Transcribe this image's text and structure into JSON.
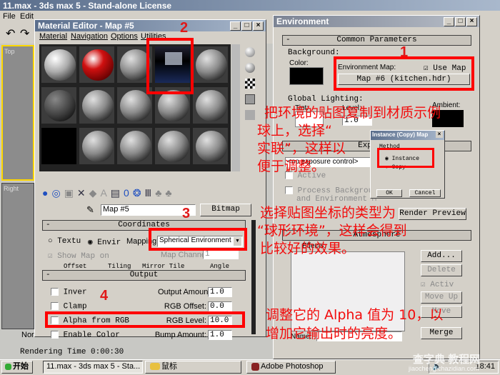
{
  "main_window": {
    "title": "11.max - 3ds max 5 - Stand-alone License",
    "menu": [
      "File",
      "Edit"
    ],
    "viewports": [
      "Top",
      "Right"
    ],
    "status_left": "Nor",
    "render_time": "Rendering Time  0:00:30"
  },
  "material_editor": {
    "title": "Material Editor - Map #5",
    "menu": [
      "Material",
      "Navigation",
      "Options",
      "Utilities"
    ],
    "map_name": "Map #5",
    "map_type": "Bitmap",
    "coordinates": {
      "header": "Coordinates",
      "texture_label": "Textu",
      "environ_label": "Envir",
      "mapping_label": "Mapping:",
      "mapping_value": "Spherical Environment",
      "show_map": "Show Map on",
      "map_channel_label": "Map Channel:",
      "map_channel": "1",
      "cols": [
        "Offset",
        "Tiling",
        "Mirror Tile",
        "Angle"
      ]
    },
    "output": {
      "header": "Output",
      "invert": "Inver",
      "clamp": "Clamp",
      "alpha_from_rgb": "Alpha from RGB",
      "enable_color": "Enable Color",
      "output_amount_label": "Output Amount:",
      "output_amount": "1.0",
      "rgb_offset_label": "RGB Offset:",
      "rgb_offset": "0.0",
      "rgb_level_label": "RGB Level:",
      "rgb_level": "10.0",
      "bump_amount_label": "Bump Amount:",
      "bump_amount": "1.0"
    }
  },
  "environment": {
    "title": "Environment",
    "common_header": "Common Parameters",
    "background_label": "Background:",
    "color_label": "Color:",
    "env_map_label": "Environment Map:",
    "use_map": "Use Map",
    "env_map_button": "Map #6 (kitchen.hdr)",
    "global_lighting": "Global Lighting:",
    "tint_label": "Tint:",
    "level_label": "Level:",
    "level_value": "1.0",
    "ambient_label": "Ambient:",
    "exposure_header": "Exposure",
    "exposure_value": "<no exposure control>",
    "active": "Active",
    "process_bg_1": "Process Background",
    "process_bg_2": "and Environment M",
    "render_preview": "Render Preview",
    "atmosphere_header": "Atmosphere",
    "effects_label": "Effects:",
    "add": "Add...",
    "delete": "Delete",
    "activ": "Activ",
    "move_up": "Move Up",
    "move_down": "Move Down",
    "name_label": "Name:",
    "merge": "Merge"
  },
  "instance_dialog": {
    "title": "Instance (Copy) Map",
    "method": "Method",
    "instance": "Instance",
    "copy": "Copy",
    "ok": "OK",
    "cancel": "Cancel"
  },
  "annotations": {
    "n1": "1",
    "n2": "2",
    "n3": "3",
    "n4": "4",
    "text1": [
      "把环境的贴图复制到材质示例",
      "球上，选择“",
      "实联”，这样以",
      "便于调整。"
    ],
    "text2": [
      "选择贴图坐标的类型为",
      "“球形环境”，这样会得到",
      "比较好的效果。"
    ],
    "text3": [
      "调整它的 Alpha 值为 10，以",
      "增加它输出时的亮度。"
    ],
    "color": "#f20c0c"
  },
  "taskbar": {
    "start": "开始",
    "items": [
      "11.max - 3ds max 5 - Sta...",
      "鼠标",
      "Adobe Photoshop"
    ],
    "clock": "18:41"
  },
  "watermark": [
    "查字典 教程网",
    "jiaocheng.chazidian.com"
  ]
}
